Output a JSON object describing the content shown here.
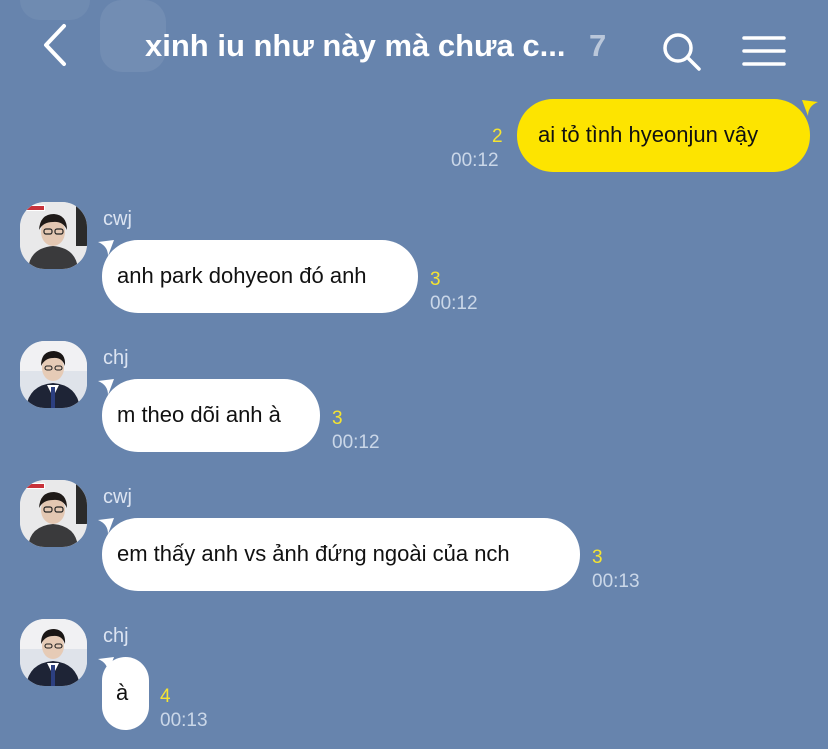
{
  "header": {
    "title": "xinh iu như này mà chưa c...",
    "member_count": "7",
    "back_icon": "chevron-left-icon",
    "search_icon": "search-icon",
    "menu_icon": "hamburger-menu-icon"
  },
  "colors": {
    "background": "#6784ad",
    "my_bubble": "#fde400",
    "their_bubble": "#ffffff",
    "unread": "#f5e431"
  },
  "messages": [
    {
      "sender": "",
      "text": "ai tỏ tình hyeonjun vậy",
      "unread": "2",
      "time": "00:12",
      "mine": true
    },
    {
      "sender": "cwj",
      "text": "anh park dohyeon đó anh",
      "unread": "3",
      "time": "00:12",
      "mine": false
    },
    {
      "sender": "chj",
      "text": "m theo dõi anh à",
      "unread": "3",
      "time": "00:12",
      "mine": false
    },
    {
      "sender": "cwj",
      "text": "em thấy anh vs ảnh đứng ngoài của nch",
      "unread": "3",
      "time": "00:13",
      "mine": false
    },
    {
      "sender": "chj",
      "text": "à",
      "unread": "4",
      "time": "00:13",
      "mine": false
    }
  ]
}
